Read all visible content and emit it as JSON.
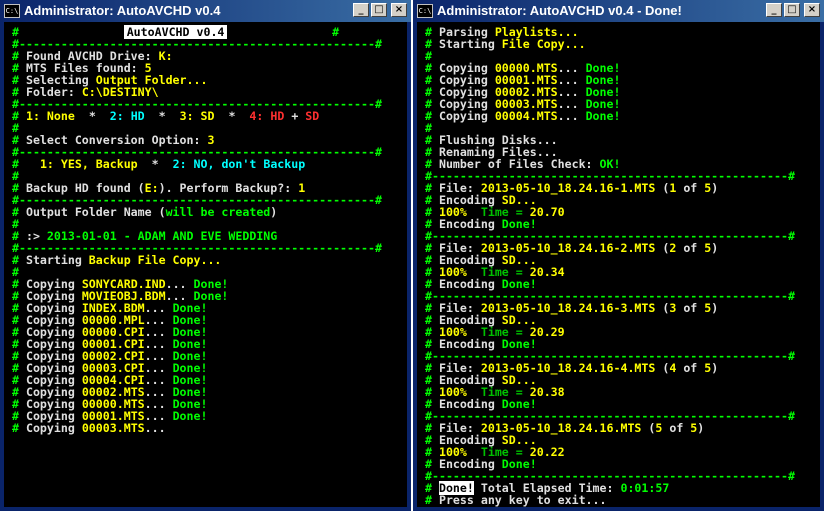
{
  "left": {
    "title": "Administrator:  AutoAVCHD v0.4",
    "banner": "AutoAVCHD v0.4",
    "found_drive_label": "Found AVCHD Drive:",
    "found_drive_value": "K:",
    "mts_found_label": "MTS Files found:",
    "mts_found_value": "5",
    "selecting_label": "Selecting",
    "selecting_value": "Output Folder...",
    "folder_label": "Folder:",
    "folder_value": "C:\\DESTINY\\",
    "opt_none": "1: None",
    "opt_hd": "2: HD",
    "opt_sd": "3: SD",
    "opt_hdsd_1": "4: HD",
    "opt_hdsd_plus": "+",
    "opt_hdsd_2": "SD",
    "star": "*",
    "select_label": "Select Conversion Option:",
    "select_value": "3",
    "backup_yes": "1: YES, Backup",
    "backup_no": "2: NO, don't Backup",
    "backup_found_1": "Backup HD found (",
    "backup_found_drive": "E:",
    "backup_found_2": "). Perform Backup?:",
    "backup_found_value": "1",
    "output_name_label": "Output Folder Name (",
    "output_name_hint": "will be created",
    "output_name_close": ")",
    "prompt": ":>",
    "output_name_value": "2013-01-01 - ADAM AND EVE WEDDING",
    "starting_label": "Starting",
    "starting_value": "Backup File Copy...",
    "copying_word": "Copying",
    "done_word": "Done!",
    "copies": [
      {
        "file": "SONYCARD.IND",
        "done": true
      },
      {
        "file": "MOVIEOBJ.BDM",
        "done": true
      },
      {
        "file": "INDEX.BDM",
        "done": true
      },
      {
        "file": "00000.MPL",
        "done": true
      },
      {
        "file": "00000.CPI",
        "done": true
      },
      {
        "file": "00001.CPI",
        "done": true
      },
      {
        "file": "00002.CPI",
        "done": true
      },
      {
        "file": "00003.CPI",
        "done": true
      },
      {
        "file": "00004.CPI",
        "done": true
      },
      {
        "file": "00002.MTS",
        "done": true
      },
      {
        "file": "00000.MTS",
        "done": true
      },
      {
        "file": "00001.MTS",
        "done": true
      },
      {
        "file": "00003.MTS",
        "done": false
      }
    ]
  },
  "right": {
    "title": "Administrator:  AutoAVCHD v0.4 - Done!",
    "parsing_label": "Parsing",
    "parsing_value": "Playlists...",
    "starting_label": "Starting",
    "starting_value": "File Copy...",
    "copying_word": "Copying",
    "done_word": "Done!",
    "copies": [
      "00000.MTS",
      "00001.MTS",
      "00002.MTS",
      "00003.MTS",
      "00004.MTS"
    ],
    "flushing": "Flushing Disks...",
    "renaming": "Renaming Files...",
    "files_check_label": "Number of Files Check:",
    "files_check_value": "OK!",
    "file_label": "File:",
    "encoding_label": "Encoding",
    "encoding_value": "SD...",
    "percent": "100%",
    "time_label": "Time =",
    "encoding_done_label": "Encoding",
    "encoding_done_value": "Done!",
    "encodes": [
      {
        "file": "2013-05-10_18.24.16-1.MTS",
        "index": "1",
        "of": "of",
        "total": "5",
        "time": "20.70"
      },
      {
        "file": "2013-05-10_18.24.16-2.MTS",
        "index": "2",
        "of": "of",
        "total": "5",
        "time": "20.34"
      },
      {
        "file": "2013-05-10_18.24.16-3.MTS",
        "index": "3",
        "of": "of",
        "total": "5",
        "time": "20.29"
      },
      {
        "file": "2013-05-10_18.24.16-4.MTS",
        "index": "4",
        "of": "of",
        "total": "5",
        "time": "20.38"
      },
      {
        "file": "2013-05-10_18.24.16.MTS",
        "index": "5",
        "of": "of",
        "total": "5",
        "time": "20.22"
      }
    ],
    "final_done": "Done!",
    "elapsed_label": "Total Elapsed Time:",
    "elapsed_value": "0:01:57",
    "press_key": "Press any key to exit..."
  },
  "controls": {
    "minimize": "_",
    "maximize": "□",
    "close": "×",
    "sys_icon": "C:\\"
  }
}
